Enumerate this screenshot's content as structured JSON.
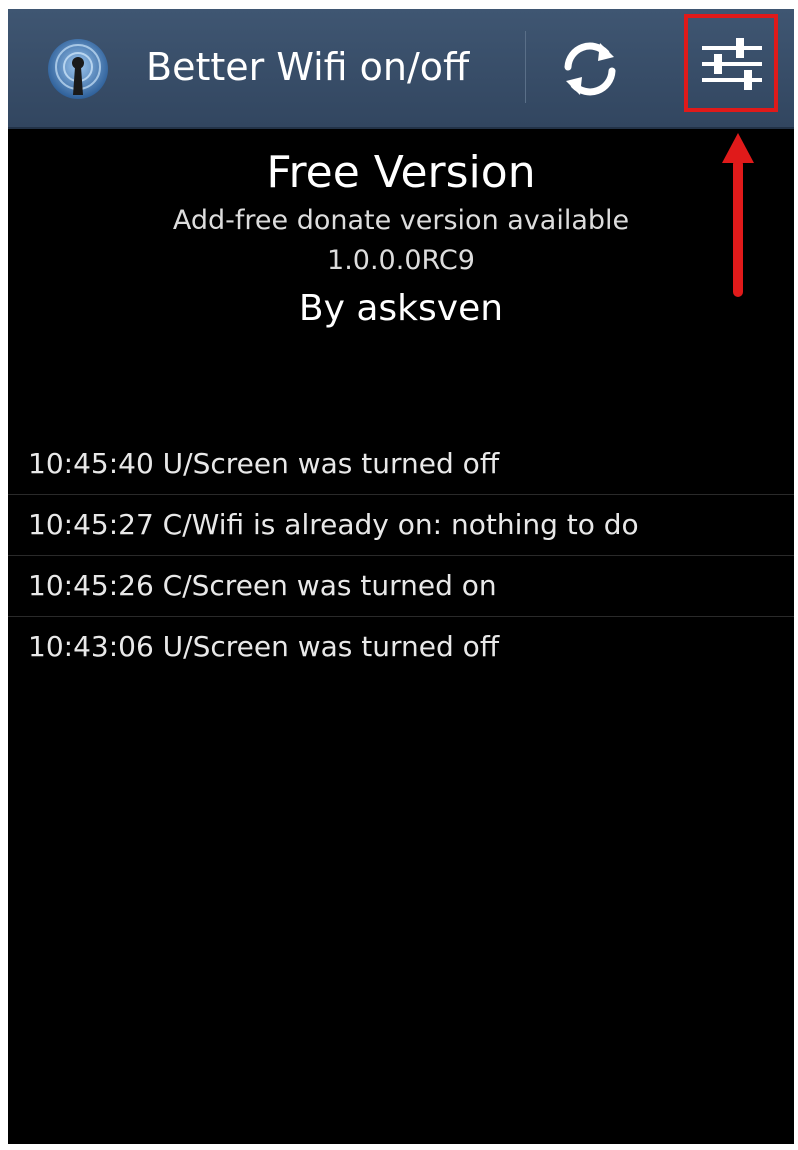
{
  "action_bar": {
    "title": "Better Wifi on/off",
    "app_icon": "wifi-antenna-icon",
    "refresh_icon": "refresh-icon",
    "settings_icon": "sliders-settings-icon",
    "background_color": "#3b506b"
  },
  "annotation": {
    "highlight_color": "#e01a1a",
    "highlight_target": "settings-button",
    "arrow_icon": "up-arrow-icon"
  },
  "header": {
    "title": "Free Version",
    "donate_text": "Add-free donate version available",
    "version": "1.0.0.0RC9",
    "author": "By asksven"
  },
  "log": {
    "entries": [
      "10:45:40 U/Screen was turned off",
      "10:45:27 C/Wifi is already on: nothing to do",
      "10:45:26 C/Screen was turned on",
      "10:43:06 U/Screen was turned off"
    ]
  }
}
